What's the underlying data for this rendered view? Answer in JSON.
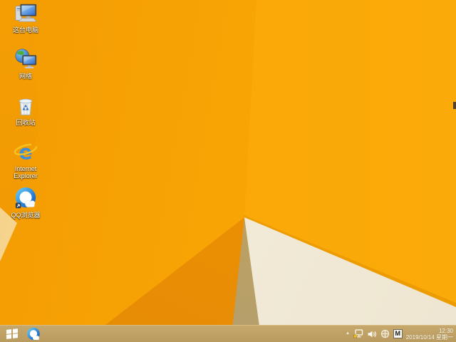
{
  "desktop": {
    "icons": [
      {
        "id": "this-pc",
        "icon": "computer-icon",
        "label": "这台电脑"
      },
      {
        "id": "network",
        "icon": "network-globe-icon",
        "label": "网络"
      },
      {
        "id": "recycle-bin",
        "icon": "recycle-bin-icon",
        "label": "回收站"
      },
      {
        "id": "internet-explorer",
        "icon": "internet-explorer-icon",
        "label": "Internet Explorer"
      },
      {
        "id": "qq-browser",
        "icon": "qq-browser-icon",
        "label": "QQ浏览器"
      }
    ]
  },
  "taskbar": {
    "start": {
      "icon": "windows-start-icon"
    },
    "pinned": [
      {
        "id": "qq-browser",
        "icon": "qq-browser-icon"
      }
    ],
    "tray": {
      "hidden_icons_arrow": "▴",
      "icons": [
        "network-status-warning-icon",
        "volume-icon",
        "globe-crosshair-icon",
        "ime-indicator"
      ],
      "ime_indicator": "M",
      "clock": {
        "time": "12:30",
        "date": "2019/10/14 星期一"
      }
    }
  },
  "colors": {
    "wallpaper_orange": "#f8a405",
    "wallpaper_dark_orange": "#e78c05",
    "wallpaper_cream": "#f3ecda",
    "wallpaper_olive": "#c0a25e",
    "taskbar_tan": "#bf9f62",
    "ie_blue": "#3a8ede",
    "qq_blue": "#1565c8"
  }
}
